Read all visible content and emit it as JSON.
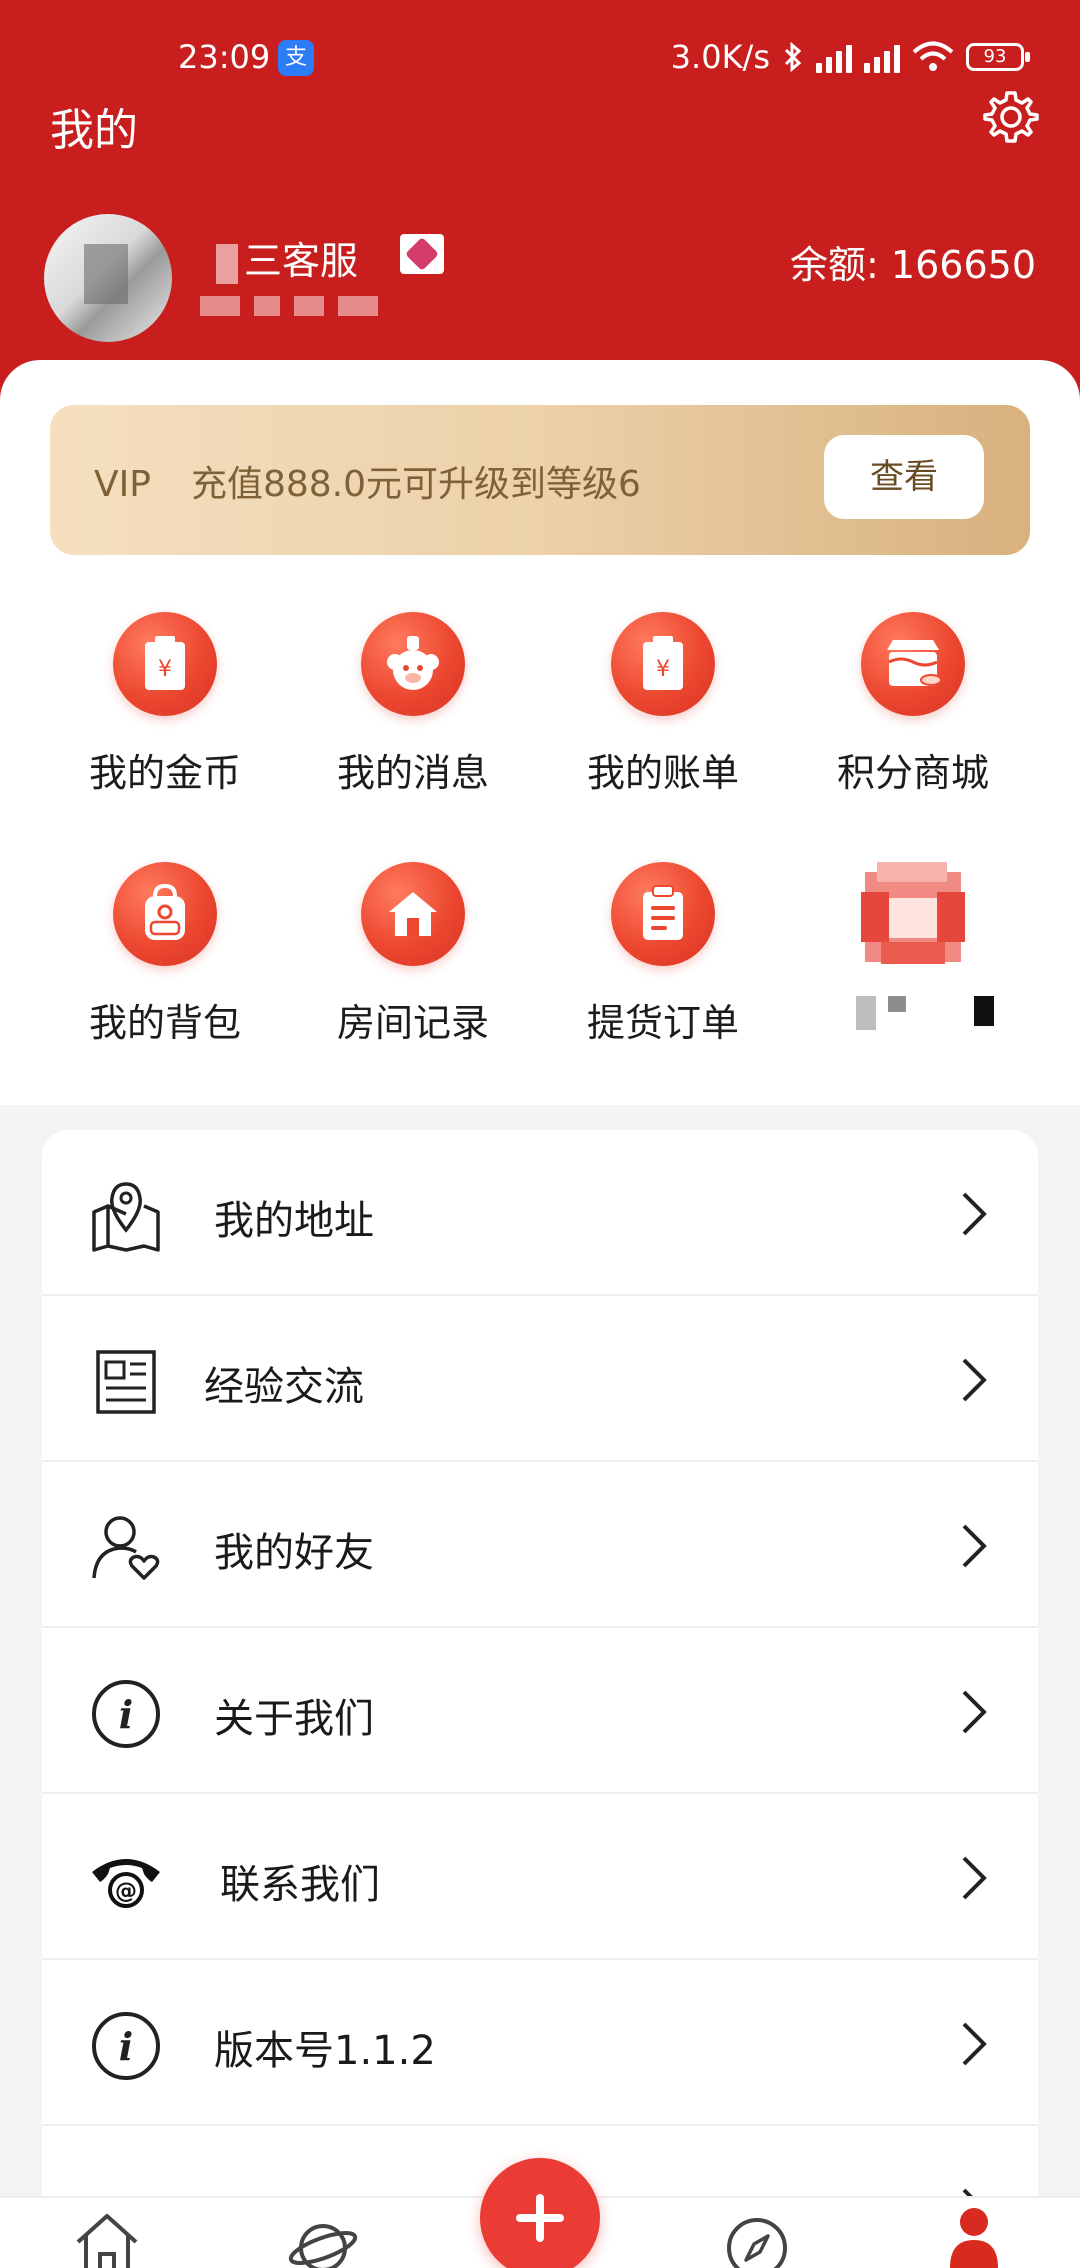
{
  "status_bar": {
    "time": "23:09",
    "app_badge": "支",
    "network_speed": "3.0K/s",
    "battery": "93"
  },
  "header": {
    "title": "我的",
    "user_name_suffix": "三客服",
    "balance": "余额: 166650"
  },
  "vip": {
    "label": "VIP",
    "message": "充值888.0元可升级到等级6",
    "button": "查看"
  },
  "grid": [
    {
      "label": "我的金币",
      "icon": "coin-wallet-icon"
    },
    {
      "label": "我的消息",
      "icon": "mascot-message-icon"
    },
    {
      "label": "我的账单",
      "icon": "bill-icon"
    },
    {
      "label": "积分商城",
      "icon": "points-store-icon"
    },
    {
      "label": "我的背包",
      "icon": "backpack-icon"
    },
    {
      "label": "房间记录",
      "icon": "house-icon"
    },
    {
      "label": "提货订单",
      "icon": "clipboard-icon"
    },
    {
      "label": "",
      "icon": "pixelated-icon"
    }
  ],
  "menu": [
    {
      "label": "我的地址",
      "icon": "map-pin-icon"
    },
    {
      "label": "经验交流",
      "icon": "newspaper-icon"
    },
    {
      "label": "我的好友",
      "icon": "friend-heart-icon"
    },
    {
      "label": "关于我们",
      "icon": "info-icon"
    },
    {
      "label": "联系我们",
      "icon": "telephone-icon"
    },
    {
      "label": "版本号1.1.2",
      "icon": "info-icon"
    }
  ],
  "tabbar": [
    "home-icon",
    "planet-icon",
    "add-icon",
    "compass-icon",
    "profile-icon"
  ],
  "colors": {
    "header_red": "#c91e1e",
    "icon_red": "#ec4730",
    "vip_gold": "#ecd1a9",
    "vip_text": "#7e6137"
  }
}
